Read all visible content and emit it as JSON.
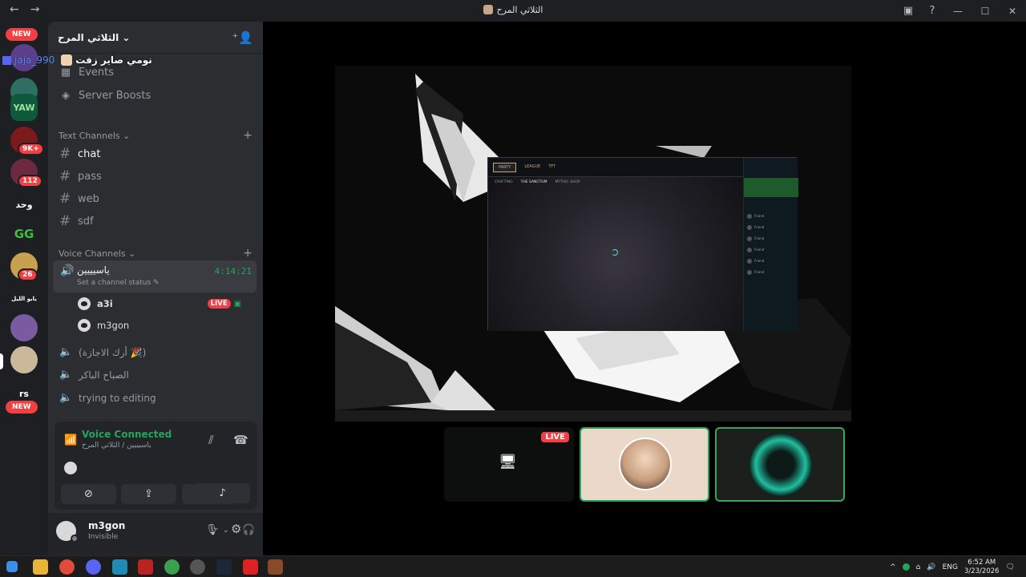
{
  "window": {
    "title": "الثلاثي المرح",
    "back_glyph": "←",
    "forward_glyph": "→",
    "inbox_icon": "inbox-icon",
    "help_glyph": "?",
    "minimize_glyph": "—",
    "maximize_glyph": "☐",
    "close_glyph": "✕"
  },
  "rail": {
    "new_label_top": "NEW",
    "new_label_bottom": "NEW",
    "servers": [
      {
        "text": "",
        "color": "#5b3f8c"
      },
      {
        "text": "",
        "color": "#2f6f63"
      },
      {
        "text": "YAW",
        "color": "#0f5a3c"
      },
      {
        "text": "",
        "color": "#7a1a1a",
        "badge": "9K+"
      },
      {
        "text": "",
        "color": "#6b2a3f",
        "badge": "112"
      },
      {
        "text": "وحد",
        "color": "#1e1f22"
      },
      {
        "text": "GG",
        "color": "#1e1f22"
      },
      {
        "text": "",
        "color": "#c9a050",
        "badge": "26"
      },
      {
        "text": "يابو الليل",
        "color": "#1e1f22"
      },
      {
        "text": "",
        "color": "#7a5aa0"
      },
      {
        "text": "",
        "color": "#c9b89a"
      },
      {
        "text": "rs",
        "color": "#1e1f22"
      }
    ]
  },
  "sidebar": {
    "server_name": "الثلاثي المرح",
    "overlay_user": "_990",
    "overlay_user_prefix": "jaja",
    "overlay_message": "نومي صاير زفت",
    "items": [
      {
        "label": "Events"
      },
      {
        "label": "Server Boosts"
      }
    ],
    "text_category": "Text Channels",
    "text_channels": [
      {
        "label": "chat",
        "active": true
      },
      {
        "label": "pass"
      },
      {
        "label": "web"
      },
      {
        "label": "sdf"
      }
    ],
    "voice_category": "Voice Channels",
    "active_voice": {
      "name": "ياسيييين",
      "timer": "4:14:21",
      "status": "Set a channel status"
    },
    "voice_users": [
      {
        "name": "a3i",
        "live": "LIVE"
      },
      {
        "name": "m3gon"
      }
    ],
    "other_voice": [
      {
        "label": "(أرك الاجازة 🎉)"
      },
      {
        "label": "الصباح الباكر"
      },
      {
        "label": "trying to editing"
      }
    ]
  },
  "voice_panel": {
    "title": "Voice Connected",
    "subtitle": "ياسيييين / الثلاثي المرح",
    "buttons": [
      {
        "icon": "camera-off-icon",
        "glyph": "⊘"
      },
      {
        "icon": "screen-share-icon",
        "glyph": "⇪"
      },
      {
        "icon": "activities-icon",
        "glyph": "✦"
      },
      {
        "icon": "soundboard-icon",
        "glyph": "♪"
      }
    ]
  },
  "user": {
    "name": "m3gon",
    "status": "Invisible"
  },
  "stage": {
    "game_tabs": [
      "PARTY",
      "LEAGUE",
      "TFT"
    ],
    "game_subtabs": [
      "CRAFTING",
      "THE SANCTUM",
      "MYTHIC SHOP"
    ],
    "friends": [
      "Friend",
      "Friend",
      "Friend",
      "Friend",
      "Friend",
      "Friend"
    ],
    "thumb_live": "LIVE"
  },
  "taskbar": {
    "lang": "ENG",
    "time": "6:52 AM",
    "date": "3/23/2026",
    "tray_up": "^"
  },
  "colors": {
    "accent_green": "#23a55a",
    "live_red": "#f23f43",
    "link_blue": "#5b8cff"
  }
}
